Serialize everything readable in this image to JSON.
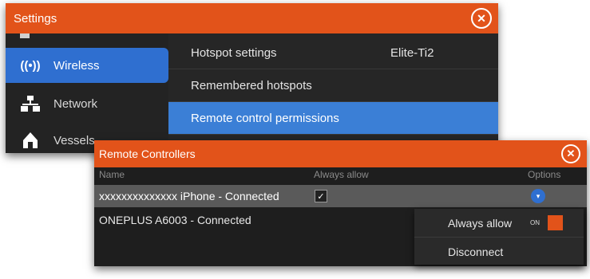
{
  "settings": {
    "title": "Settings",
    "close_icon": "close-icon",
    "sidebar": {
      "items": [
        {
          "label": "Wireless",
          "icon": "wireless-icon",
          "glyph": "((•))"
        },
        {
          "label": "Network",
          "icon": "network-icon",
          "glyph": "⊤"
        },
        {
          "label": "Vessels",
          "icon": "vessel-icon",
          "glyph": "▲"
        }
      ]
    },
    "menu": [
      {
        "label": "Hotspot settings",
        "value": "Elite-Ti2"
      },
      {
        "label": "Remembered hotspots"
      },
      {
        "label": "Remote control permissions"
      }
    ]
  },
  "remote": {
    "title": "Remote Controllers",
    "columns": [
      "Name",
      "Always allow",
      "Options"
    ],
    "rows": [
      {
        "name": "xxxxxxxxxxxxxx iPhone - Connected",
        "always_allow": true
      },
      {
        "name": "ONEPLUS A6003 - Connected",
        "always_allow": false
      }
    ]
  },
  "popup": {
    "items": [
      {
        "label": "Always allow",
        "toggle_text": "ON"
      },
      {
        "label": "Disconnect"
      }
    ]
  },
  "colors": {
    "accent_orange": "#e2531a",
    "selection_blue": "#3b7fd6"
  }
}
